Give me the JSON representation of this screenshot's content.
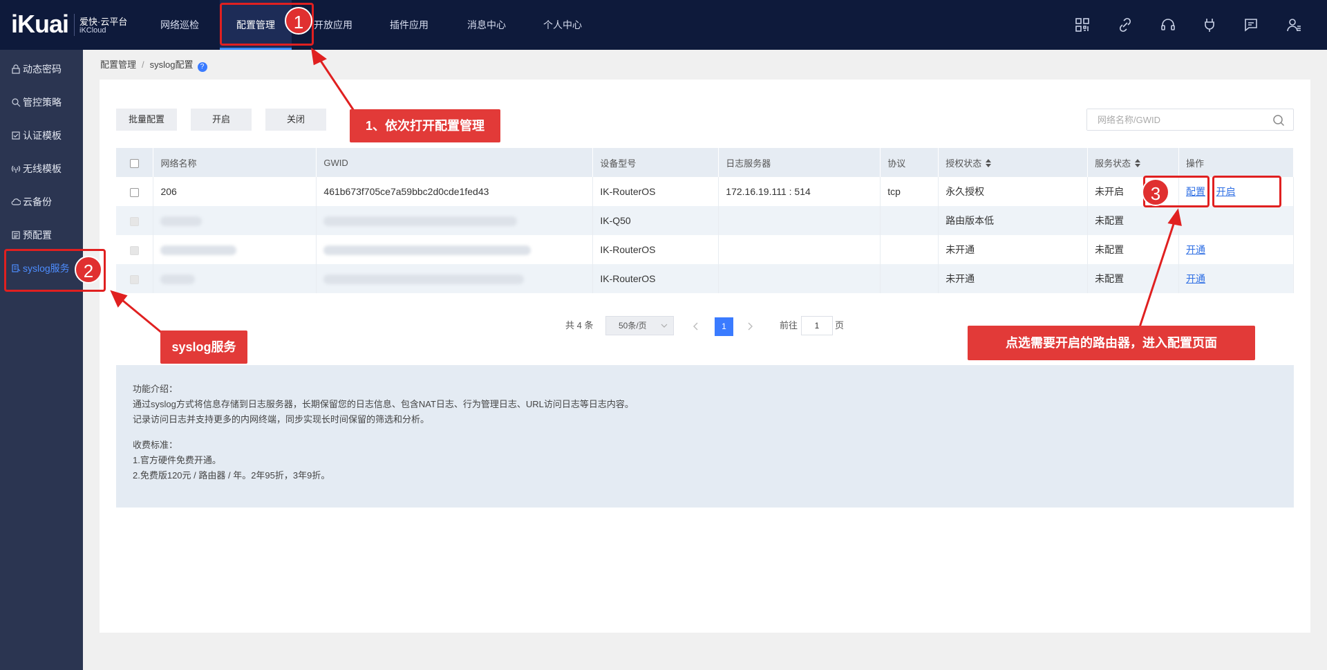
{
  "logo": {
    "brand": "iKuai",
    "sub_cn": "爱快·云平台",
    "sub_en": "iKCloud"
  },
  "topnav": {
    "items": [
      {
        "label": "网络巡检"
      },
      {
        "label": "配置管理"
      },
      {
        "label": "开放应用"
      },
      {
        "label": "插件应用"
      },
      {
        "label": "消息中心"
      },
      {
        "label": "个人中心"
      }
    ],
    "icons": [
      "grid-icon",
      "link-icon",
      "headset-icon",
      "plug-icon",
      "message-icon",
      "user-icon"
    ]
  },
  "sidebar": {
    "items": [
      {
        "label": "动态密码",
        "icon": "lock-icon"
      },
      {
        "label": "管控策略",
        "icon": "policy-icon"
      },
      {
        "label": "认证模板",
        "icon": "auth-template-icon"
      },
      {
        "label": "无线模板",
        "icon": "wireless-icon"
      },
      {
        "label": "云备份",
        "icon": "cloud-icon"
      },
      {
        "label": "预配置",
        "icon": "preconfig-icon"
      },
      {
        "label": "syslog服务",
        "icon": "syslog-icon"
      }
    ]
  },
  "breadcrumb": {
    "parent": "配置管理",
    "sep": "/",
    "current": "syslog配置",
    "help": "?"
  },
  "toolbar": {
    "batch_label": "批量配置",
    "enable_label": "开启",
    "disable_label": "关闭"
  },
  "search": {
    "placeholder": "网络名称/GWID"
  },
  "table": {
    "headers": [
      "网络名称",
      "GWID",
      "设备型号",
      "日志服务器",
      "协议",
      "授权状态",
      "服务状态",
      "操作"
    ],
    "rows": [
      {
        "name": "206",
        "gwid": "461b673f705ce7a59bbc2d0cde1fed43",
        "model": "IK-RouterOS",
        "server": "172.16.19.111 : 514",
        "protocol": "tcp",
        "auth": "永久授权",
        "status": "未开启",
        "action1": "配置",
        "action2": "开启"
      },
      {
        "name": "",
        "gwid": "",
        "model": "IK-Q50",
        "server": "",
        "protocol": "",
        "auth": "路由版本低",
        "status": "未配置",
        "action1": "",
        "action2": ""
      },
      {
        "name": "",
        "gwid": "",
        "model": "IK-RouterOS",
        "server": "",
        "protocol": "",
        "auth": "未开通",
        "status": "未配置",
        "action1": "开通",
        "action2": ""
      },
      {
        "name": "",
        "gwid": "",
        "model": "IK-RouterOS",
        "server": "",
        "protocol": "",
        "auth": "未开通",
        "status": "未配置",
        "action1": "开通",
        "action2": ""
      }
    ]
  },
  "pagination": {
    "total": "共 4 条",
    "page_size": "50条/页",
    "current": "1",
    "goto_label": "前往",
    "goto_value": "1",
    "page_unit": "页"
  },
  "info": {
    "title": "功能介绍：",
    "line1": "通过syslog方式将信息存储到日志服务器，长期保留您的日志信息、包含NAT日志、行为管理日志、URL访问日志等日志内容。",
    "line2": "记录访问日志并支持更多的内网终端，同步实现长时间保留的筛选和分析。",
    "fee_title": "收费标准：",
    "fee1": "1.官方硬件免费开通。",
    "fee2": "2.免费版120元 / 路由器 / 年。2年95折，3年9折。"
  },
  "annotations": {
    "badge1": "1",
    "badge2": "2",
    "badge3": "3",
    "callout1": "1、依次打开配置管理",
    "callout2": "syslog服务",
    "callout3": "点选需要开启的路由器，进入配置页面",
    "color": "#e02020"
  }
}
